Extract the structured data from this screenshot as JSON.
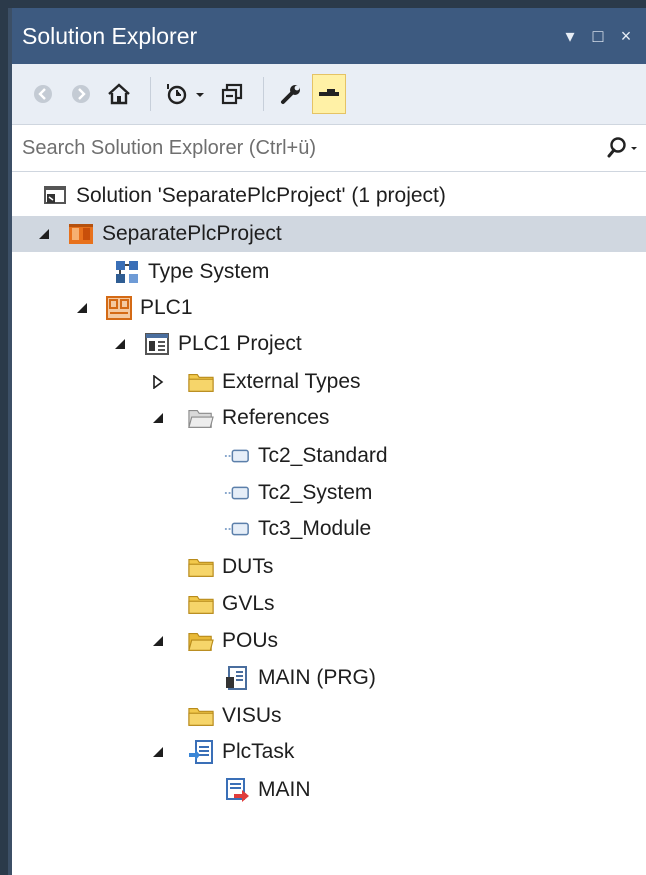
{
  "window": {
    "title": "Solution Explorer",
    "buttons": {
      "dropdown": "▾",
      "maximize": "□",
      "close": "×"
    }
  },
  "toolbar": {
    "buttons": [
      "back-icon",
      "forward-icon",
      "home-icon",
      "pending-changes-filter-icon",
      "collapse-all-icon",
      "properties-icon",
      "preview-selected-icon"
    ]
  },
  "search": {
    "placeholder": "Search Solution Explorer (Ctrl+ü)",
    "value": ""
  },
  "tree": {
    "items": [
      {
        "label": "Solution 'SeparatePlcProject' (1 project)",
        "icon": "solution-icon",
        "expander": "none"
      },
      {
        "label": "SeparatePlcProject",
        "icon": "twincat-project-icon",
        "expander": "expanded"
      },
      {
        "label": "Type System",
        "icon": "type-system-icon",
        "expander": "none"
      },
      {
        "label": "PLC1",
        "icon": "plc-icon",
        "expander": "expanded"
      },
      {
        "label": "PLC1 Project",
        "icon": "plc-project-icon",
        "expander": "expanded"
      },
      {
        "label": "External Types",
        "icon": "folder-icon",
        "expander": "collapsed"
      },
      {
        "label": "References",
        "icon": "folder-open-gray-icon",
        "expander": "expanded"
      },
      {
        "label": "Tc2_Standard",
        "icon": "reference-icon",
        "expander": "none"
      },
      {
        "label": "Tc2_System",
        "icon": "reference-icon",
        "expander": "none"
      },
      {
        "label": "Tc3_Module",
        "icon": "reference-icon",
        "expander": "none"
      },
      {
        "label": "DUTs",
        "icon": "folder-icon",
        "expander": "none"
      },
      {
        "label": "GVLs",
        "icon": "folder-icon",
        "expander": "none"
      },
      {
        "label": "POUs",
        "icon": "folder-open-icon",
        "expander": "expanded"
      },
      {
        "label": "MAIN (PRG)",
        "icon": "program-icon",
        "expander": "none"
      },
      {
        "label": "VISUs",
        "icon": "folder-icon",
        "expander": "none"
      },
      {
        "label": "PlcTask",
        "icon": "task-icon",
        "expander": "expanded"
      },
      {
        "label": "MAIN",
        "icon": "task-call-icon",
        "expander": "none"
      }
    ]
  },
  "colors": {
    "titlebar": "#3d5a80",
    "toolbar": "#e9eef5",
    "selection": "#d0d7e0",
    "folder": "#f2c94c"
  }
}
